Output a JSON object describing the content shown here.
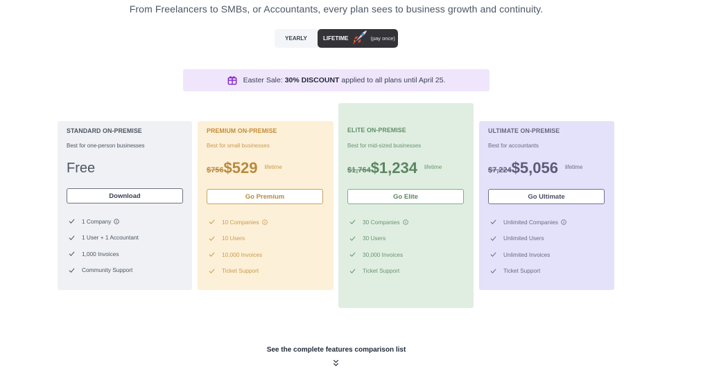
{
  "header": {
    "subtitle": "From Freelancers to SMBs, or Accountants, every plan sees to business growth and continuity."
  },
  "billing_toggle": {
    "yearly_label": "YEARLY",
    "lifetime_label": "LIFETIME",
    "lifetime_note": "(pay once)",
    "selected": "LIFETIME"
  },
  "banner": {
    "prefix": "Easter Sale: ",
    "highlight": "30% DISCOUNT",
    "suffix": " applied to all plans until April 25."
  },
  "plans": [
    {
      "name": "STANDARD ON-PREMISE",
      "description": "Best for one-person businesses",
      "price": "Free",
      "cta": "Download",
      "features": [
        "1 Company",
        "1 User + 1 Accountant",
        "1,000 Invoices",
        "Community Support"
      ],
      "color": "#f0f1f4"
    },
    {
      "name": "PREMIUM ON-PREMISE",
      "description": "Best for small businesses",
      "old_price": "$756",
      "price": "$529",
      "price_suffix": "lifetime",
      "cta": "Go Premium",
      "features": [
        "10 Companies",
        "10 Users",
        "10,000 Invoices",
        "Ticket Support"
      ],
      "color": "#fdf0d8"
    },
    {
      "name": "ELITE ON-PREMISE",
      "description": "Best for mid-sized businesses",
      "old_price": "$1,764",
      "price": "$1,234",
      "price_suffix": "lifetime",
      "cta": "Go Elite",
      "features": [
        "30 Companies",
        "30 Users",
        "30,000 Invoices",
        "Ticket Support"
      ],
      "color": "#e0eee2"
    },
    {
      "name": "ULTIMATE ON-PREMISE",
      "description": "Best for accountants",
      "old_price": "$7,224",
      "price": "$5,056",
      "price_suffix": "lifetime",
      "cta": "Go Ultimate",
      "features": [
        "Unlimited Companies",
        "Unlimited Users",
        "Unlimited Invoices",
        "Ticket Support"
      ],
      "color": "#e4e1fa"
    }
  ],
  "footer": {
    "compare_link": "See the complete features comparison list"
  },
  "icons": {
    "banner": "gift-icon",
    "toggle": "rocket-icon",
    "feature": "check-icon",
    "info": "info-icon",
    "expand": "double-chevron-down-icon"
  }
}
